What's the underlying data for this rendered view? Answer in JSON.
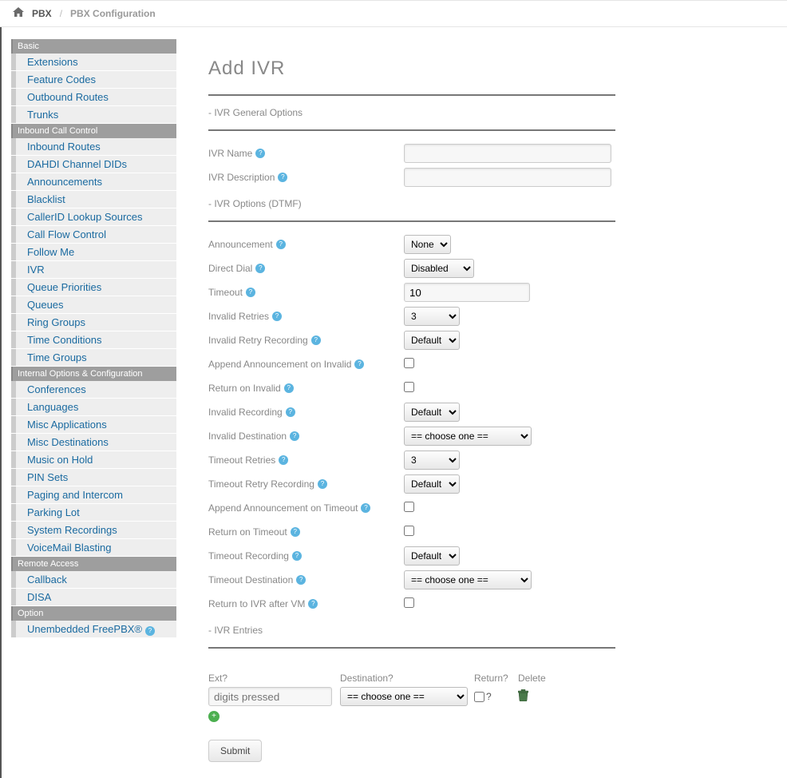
{
  "breadcrumb": {
    "root": "PBX",
    "current": "PBX Configuration",
    "sep": "/"
  },
  "sidebar": {
    "groups": [
      {
        "title": "Basic",
        "items": [
          {
            "label": "Extensions"
          },
          {
            "label": "Feature Codes"
          },
          {
            "label": "Outbound Routes"
          },
          {
            "label": "Trunks"
          }
        ]
      },
      {
        "title": "Inbound Call Control",
        "items": [
          {
            "label": "Inbound Routes"
          },
          {
            "label": "DAHDI Channel DIDs"
          },
          {
            "label": "Announcements"
          },
          {
            "label": "Blacklist"
          },
          {
            "label": "CallerID Lookup Sources"
          },
          {
            "label": "Call Flow Control"
          },
          {
            "label": "Follow Me"
          },
          {
            "label": "IVR"
          },
          {
            "label": "Queue Priorities"
          },
          {
            "label": "Queues"
          },
          {
            "label": "Ring Groups"
          },
          {
            "label": "Time Conditions"
          },
          {
            "label": "Time Groups"
          }
        ]
      },
      {
        "title": "Internal Options & Configuration",
        "items": [
          {
            "label": "Conferences"
          },
          {
            "label": "Languages"
          },
          {
            "label": "Misc Applications"
          },
          {
            "label": "Misc Destinations"
          },
          {
            "label": "Music on Hold"
          },
          {
            "label": "PIN Sets"
          },
          {
            "label": "Paging and Intercom"
          },
          {
            "label": "Parking Lot"
          },
          {
            "label": "System Recordings"
          },
          {
            "label": "VoiceMail Blasting"
          }
        ]
      },
      {
        "title": "Remote Access",
        "items": [
          {
            "label": "Callback"
          },
          {
            "label": "DISA"
          }
        ]
      },
      {
        "title": "Option",
        "items": [
          {
            "label": "Unembedded FreePBX®",
            "help": true
          }
        ]
      }
    ]
  },
  "main": {
    "title": "Add IVR",
    "sections": {
      "general": "- IVR General Options",
      "dtmf": "- IVR Options (DTMF)",
      "entries": "- IVR Entries"
    },
    "fields": {
      "ivr_name": {
        "label": "IVR Name",
        "value": ""
      },
      "ivr_description": {
        "label": "IVR Description",
        "value": ""
      },
      "announcement": {
        "label": "Announcement",
        "value": "None"
      },
      "direct_dial": {
        "label": "Direct Dial",
        "value": "Disabled"
      },
      "timeout": {
        "label": "Timeout",
        "value": "10"
      },
      "invalid_retries": {
        "label": "Invalid Retries",
        "value": "3"
      },
      "invalid_retry_recording": {
        "label": "Invalid Retry Recording",
        "value": "Default"
      },
      "append_on_invalid": {
        "label": "Append Announcement on Invalid"
      },
      "return_on_invalid": {
        "label": "Return on Invalid"
      },
      "invalid_recording": {
        "label": "Invalid Recording",
        "value": "Default"
      },
      "invalid_destination": {
        "label": "Invalid Destination",
        "value": "== choose one =="
      },
      "timeout_retries": {
        "label": "Timeout Retries",
        "value": "3"
      },
      "timeout_retry_recording": {
        "label": "Timeout Retry Recording",
        "value": "Default"
      },
      "append_on_timeout": {
        "label": "Append Announcement on Timeout"
      },
      "return_on_timeout": {
        "label": "Return on Timeout"
      },
      "timeout_recording": {
        "label": "Timeout Recording",
        "value": "Default"
      },
      "timeout_destination": {
        "label": "Timeout Destination",
        "value": "== choose one =="
      },
      "return_to_ivr": {
        "label": "Return to IVR after VM"
      }
    },
    "entries_header": {
      "ext": "Ext",
      "destination": "Destination",
      "ret": "Return",
      "del": "Delete"
    },
    "entries_row": {
      "ext_placeholder": "digits pressed",
      "destination": "== choose one =="
    },
    "submit": "Submit"
  }
}
